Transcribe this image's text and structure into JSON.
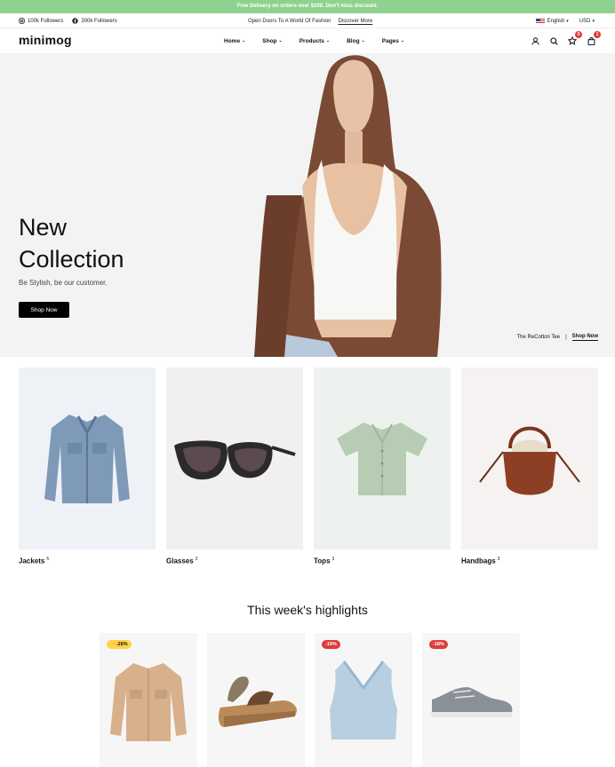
{
  "announcement": "Free Delivery on orders over $200. Don't miss discount.",
  "topbar": {
    "instagram": "100k Followers",
    "facebook": "300k Followers",
    "promo": "Open Doors To A World Of Fashion",
    "promo_link": "Discover More",
    "language": "English",
    "currency": "USD"
  },
  "nav": {
    "logo": "minimog",
    "menu": [
      {
        "label": "Home"
      },
      {
        "label": "Shop"
      },
      {
        "label": "Products"
      },
      {
        "label": "Blog"
      },
      {
        "label": "Pages"
      }
    ],
    "wishlist_count": "0",
    "cart_count": "1"
  },
  "hero": {
    "title_line1": "New",
    "title_line2": "Collection",
    "subtitle": "Be Stylish, be our customer.",
    "button": "Shop Now",
    "caption": "The ReCotton Tee",
    "caption_link": "Shop Now"
  },
  "categories": [
    {
      "name": "Jackets",
      "count": "5",
      "bg": "#eef2f7"
    },
    {
      "name": "Glasses",
      "count": "2",
      "bg": "#f1eff0"
    },
    {
      "name": "Tops",
      "count": "3",
      "bg": "#eef2ee"
    },
    {
      "name": "Handbags",
      "count": "3",
      "bg": "#f6f2f2"
    }
  ],
  "highlights": {
    "title": "This week's highlights",
    "products": [
      {
        "tag": "⚡-26%",
        "tag_style": "yellow",
        "icon": "jacket-icon"
      },
      {
        "tag": "",
        "tag_style": "",
        "icon": "sandal-icon"
      },
      {
        "tag": "-19%",
        "tag_style": "red",
        "icon": "vest-icon"
      },
      {
        "tag": "-18%",
        "tag_style": "red",
        "icon": "sneaker-icon"
      }
    ]
  }
}
